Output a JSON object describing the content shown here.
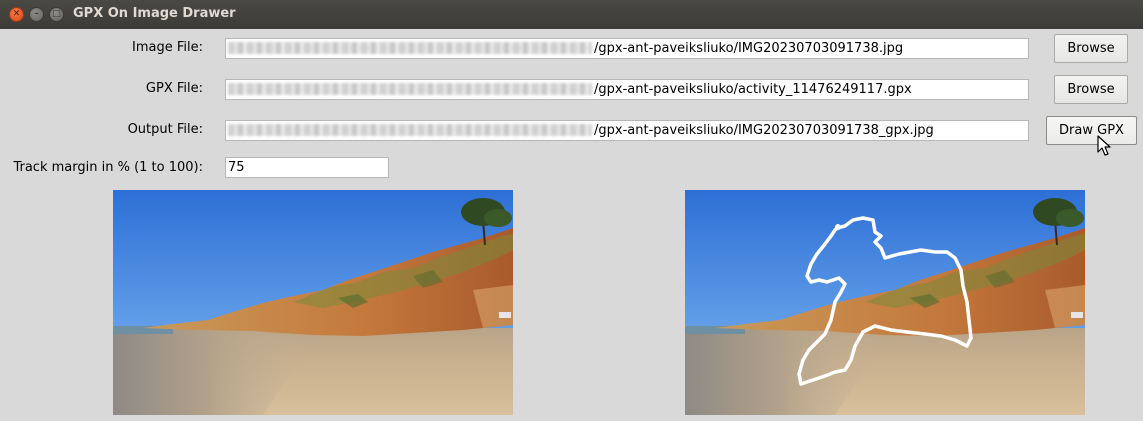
{
  "window": {
    "title": "GPX On Image Drawer"
  },
  "image_file": {
    "label": "Image File:",
    "value": "/gpx-ant-paveiksliuko/IMG20230703091738.jpg",
    "browse_label": "Browse"
  },
  "gpx_file": {
    "label": "GPX File:",
    "value": "/gpx-ant-paveiksliuko/activity_11476249117.gpx",
    "browse_label": "Browse"
  },
  "output_file": {
    "label": "Output File:",
    "value": "/gpx-ant-paveiksliuko/IMG20230703091738_gpx.jpg",
    "draw_label": "Draw GPX"
  },
  "track_margin": {
    "label": "Track margin in % (1 to 100):",
    "value": "75"
  },
  "icons": {
    "close": "close-icon",
    "minimize": "minimize-icon",
    "maximize": "maximize-icon",
    "cursor": "mouse-pointer-icon"
  },
  "colors": {
    "titlebar": "#3c3b37",
    "close_button": "#dd4814",
    "window_bg": "#d9d9d9",
    "track_line": "#ffffff"
  }
}
